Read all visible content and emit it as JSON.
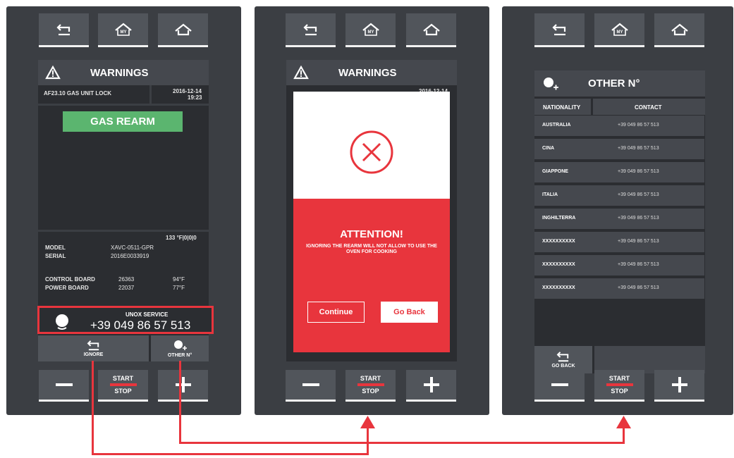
{
  "colors": {
    "accent_red": "#e8353d",
    "rearm_green": "#5bb56f",
    "panel": "#3b3e43",
    "screen": "#2b2d31"
  },
  "nav": {
    "back_icon": "back-arrow-icon",
    "my_home_icon": "my-home-icon",
    "home_icon": "home-icon",
    "my_label": "MY"
  },
  "controls": {
    "start": "START",
    "stop": "STOP"
  },
  "screen1": {
    "title": "WARNINGS",
    "alarm_code": "AF23.10 GAS UNIT LOCK",
    "date": "2016-12-14",
    "time": "19:23",
    "rearm_label": "GAS REARM",
    "counter": "133 °F|0|0|0",
    "model_label": "MODEL",
    "model_value": "XAVC-0511-GPR",
    "serial_label": "SERIAL",
    "serial_value": "2016E0033919",
    "control_board_label": "CONTROL BOARD",
    "control_board_value": "26363",
    "control_board_temp": "94°F",
    "power_board_label": "POWER BOARD",
    "power_board_value": "22037",
    "power_board_temp": "77°F",
    "service_title": "UNOX SERVICE",
    "service_phone": "+39 049 86 57 513",
    "ignore_label": "IGNORE",
    "other_label": "OTHER N°"
  },
  "screen2": {
    "title": "WARNINGS",
    "date_partial": "2016-12-14",
    "attention_title": "ATTENTION!",
    "attention_message": "IGNORING THE REARM WILL NOT ALLOW TO USE THE OVEN FOR COOKING",
    "continue_label": "Continue",
    "goback_label": "Go Back"
  },
  "screen3": {
    "title": "OTHER N°",
    "col_nationality": "NATIONALITY",
    "col_contact": "CONTACT",
    "rows": [
      {
        "nationality": "AUSTRALIA",
        "contact": "+39 049 86 57 513"
      },
      {
        "nationality": "CINA",
        "contact": "+39 049 86 57 513"
      },
      {
        "nationality": "GIAPPONE",
        "contact": "+39 049 86 57 513"
      },
      {
        "nationality": "ITALIA",
        "contact": "+39 049 86 57 513"
      },
      {
        "nationality": "INGHILTERRA",
        "contact": "+39 049 86 57 513"
      },
      {
        "nationality": "XXXXXXXXXX",
        "contact": "+39 049 86 57 513"
      },
      {
        "nationality": "XXXXXXXXXX",
        "contact": "+39 049 86 57 513"
      },
      {
        "nationality": "XXXXXXXXXX",
        "contact": "+39 049 86 57 513"
      }
    ],
    "goback_label": "GO BACK"
  }
}
